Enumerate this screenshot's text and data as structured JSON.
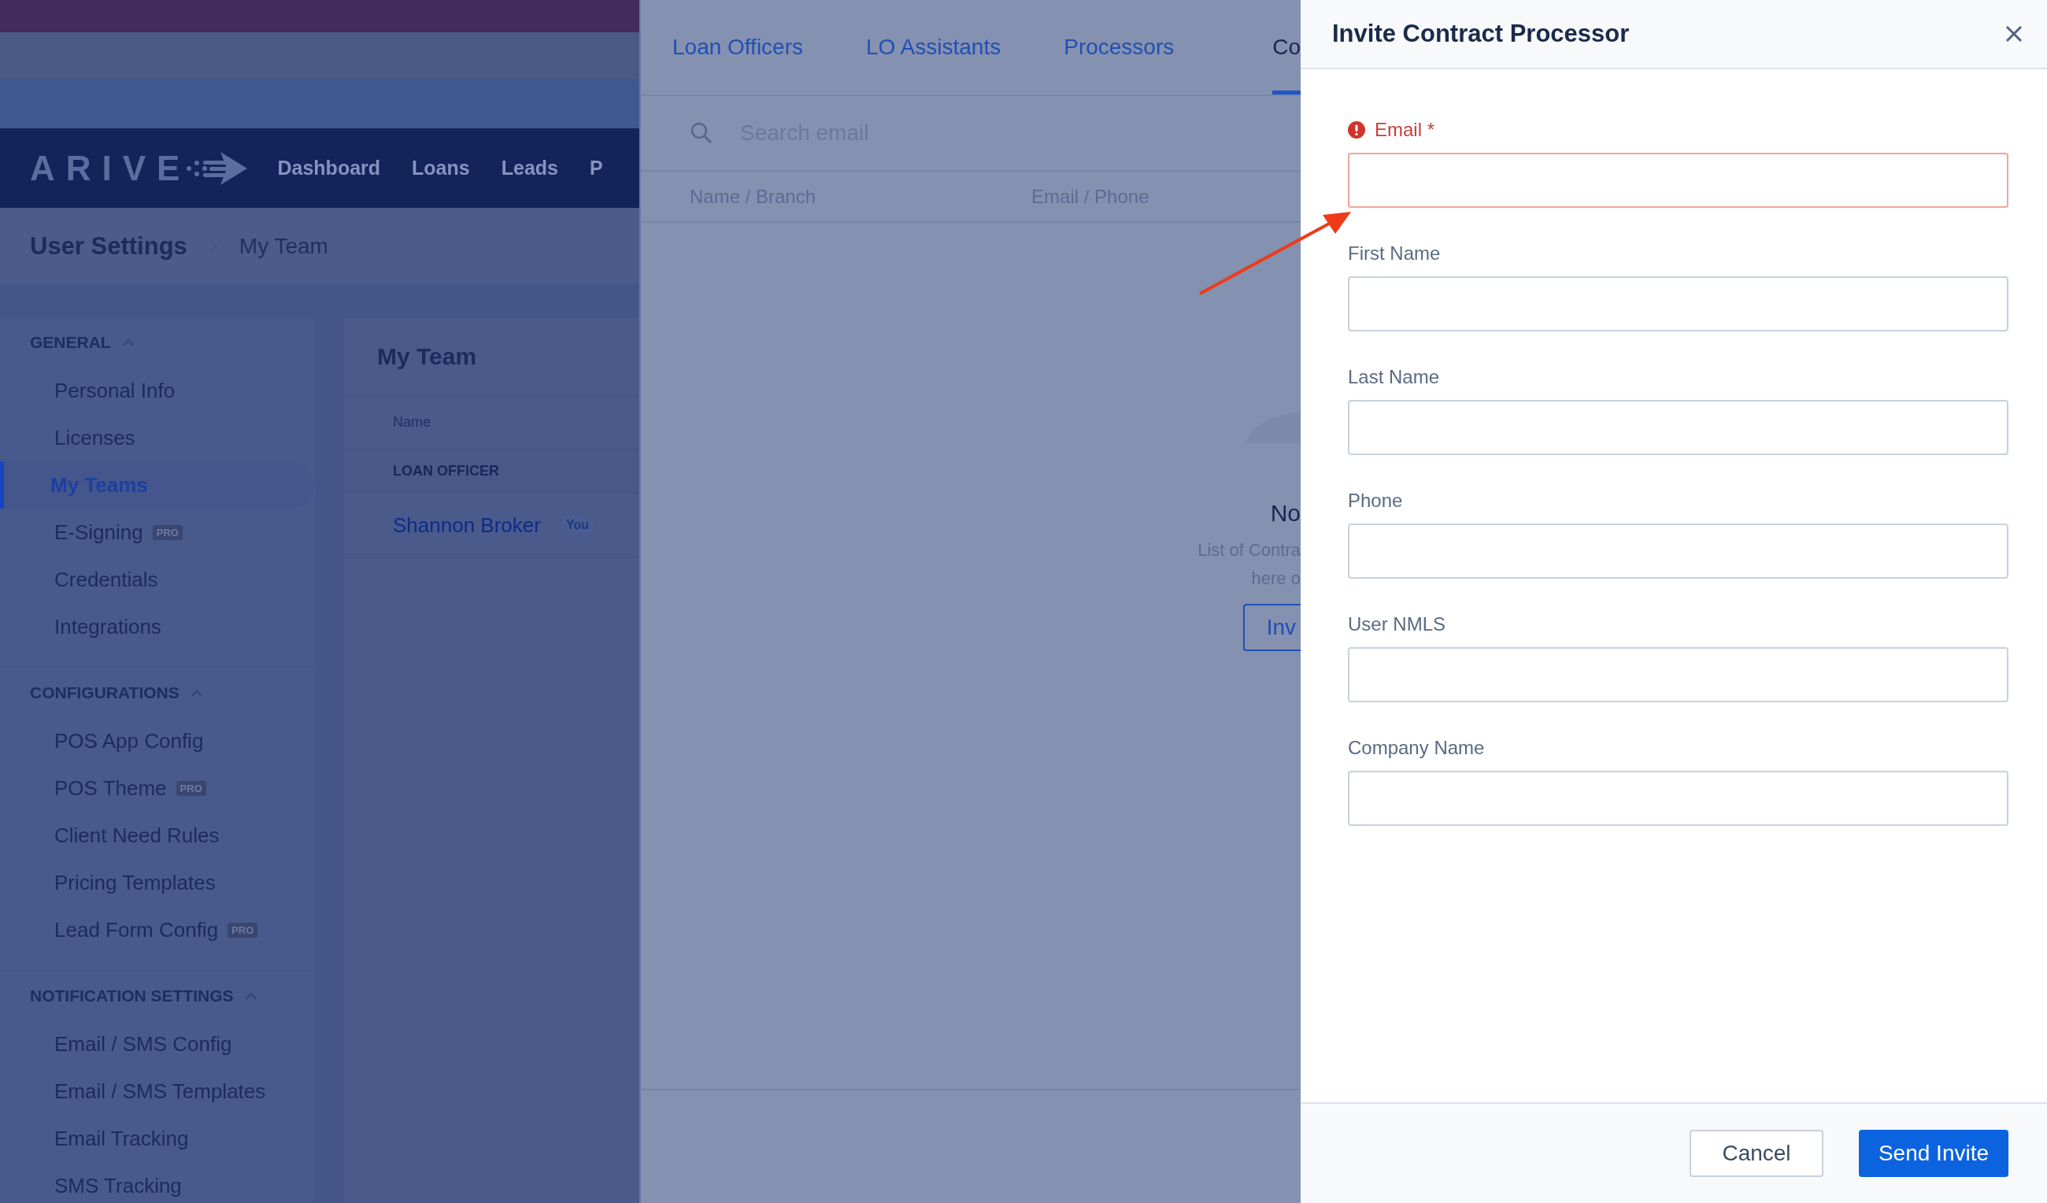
{
  "navbar": {
    "logo": "ARIVE",
    "items": [
      "Dashboard",
      "Loans",
      "Leads",
      "P"
    ]
  },
  "breadcrumb": [
    "User Settings",
    "My Team"
  ],
  "sidebar": {
    "sections": [
      {
        "title": "GENERAL",
        "expanded": true,
        "items": [
          {
            "label": "Personal Info",
            "selected": false
          },
          {
            "label": "Licenses",
            "selected": false
          },
          {
            "label": "My Teams",
            "selected": true
          },
          {
            "label": "E-Signing",
            "selected": false,
            "badge": "PRO"
          },
          {
            "label": "Credentials",
            "selected": false
          },
          {
            "label": "Integrations",
            "selected": false
          }
        ]
      },
      {
        "title": "CONFIGURATIONS",
        "expanded": true,
        "items": [
          {
            "label": "POS App Config",
            "selected": false
          },
          {
            "label": "POS Theme",
            "selected": false,
            "badge": "PRO"
          },
          {
            "label": "Client Need Rules",
            "selected": false
          },
          {
            "label": "Pricing Templates",
            "selected": false
          },
          {
            "label": "Lead Form Config",
            "selected": false,
            "badge": "PRO"
          }
        ]
      },
      {
        "title": "NOTIFICATION SETTINGS",
        "expanded": true,
        "items": [
          {
            "label": "Email / SMS Config",
            "selected": false
          },
          {
            "label": "Email / SMS Templates",
            "selected": false
          },
          {
            "label": "Email Tracking",
            "selected": false
          },
          {
            "label": "SMS Tracking",
            "selected": false
          }
        ]
      }
    ]
  },
  "team_card": {
    "title": "My Team",
    "columns": [
      "Name"
    ],
    "groups": [
      {
        "title": "LOAN OFFICER",
        "rows": [
          {
            "name": "Shannon Broker",
            "badge": "You"
          }
        ]
      }
    ]
  },
  "members_panel": {
    "tabs": [
      {
        "label": "Loan Officers",
        "selected": false
      },
      {
        "label": "LO Assistants",
        "selected": false
      },
      {
        "label": "Processors",
        "selected": false
      },
      {
        "label": "Co",
        "selected": true
      }
    ],
    "search": {
      "placeholder": "Search email"
    },
    "columns": [
      "Name / Branch",
      "Email / Phone"
    ],
    "empty_state": {
      "title": "No",
      "lines": [
        "List of Contra",
        "here o"
      ],
      "button": "Inv"
    }
  },
  "drawer": {
    "title": "Invite Contract Processor",
    "fields": [
      {
        "label": "Email *",
        "error": true
      },
      {
        "label": "First Name",
        "error": false
      },
      {
        "label": "Last Name",
        "error": false
      },
      {
        "label": "Phone",
        "error": false
      },
      {
        "label": "User NMLS",
        "error": false
      },
      {
        "label": "Company Name",
        "error": false
      }
    ],
    "buttons": [
      {
        "label": "Cancel",
        "kind": "secondary"
      },
      {
        "label": "Send Invite",
        "kind": "primary"
      }
    ]
  }
}
